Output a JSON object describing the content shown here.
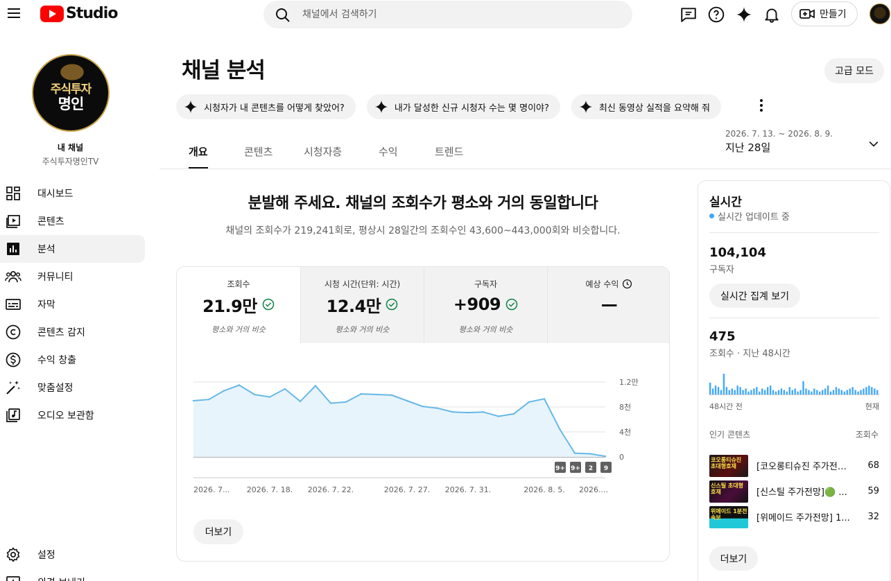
{
  "header": {
    "logo_text": "Studio",
    "search_placeholder": "채널에서 검색하기",
    "create_label": "만들기"
  },
  "sidebar": {
    "avatar_text_1": "주식투자",
    "avatar_text_2": "명인",
    "channel_label": "내 채널",
    "channel_name": "주식투자명인TV",
    "items": [
      {
        "label": "대시보드",
        "icon": "dashboard-icon"
      },
      {
        "label": "콘텐츠",
        "icon": "content-icon"
      },
      {
        "label": "분석",
        "icon": "analytics-icon"
      },
      {
        "label": "커뮤니티",
        "icon": "community-icon"
      },
      {
        "label": "자막",
        "icon": "subtitles-icon"
      },
      {
        "label": "콘텐츠 감지",
        "icon": "copyright-icon"
      },
      {
        "label": "수익 창출",
        "icon": "monetization-icon"
      },
      {
        "label": "맞춤설정",
        "icon": "customization-icon"
      },
      {
        "label": "오디오 보관함",
        "icon": "audio-library-icon"
      }
    ],
    "bottom_items": [
      {
        "label": "설정",
        "icon": "settings-icon"
      },
      {
        "label": "의견 보내기",
        "icon": "feedback-icon"
      }
    ]
  },
  "main": {
    "title": "채널 분석",
    "advanced_label": "고급 모드",
    "chips": [
      "시청자가 내 콘텐츠를 어떻게 찾았어?",
      "내가 달성한 신규 시청자 수는 몇 명이야?",
      "최신 동영상 실적을 요약해 줘"
    ],
    "tabs": [
      "개요",
      "콘텐츠",
      "시청자층",
      "수익",
      "트렌드"
    ],
    "date_range": "2026. 7. 13. ~ 2026. 8. 9.",
    "date_label": "지난 28일",
    "headline": "분발해 주세요. 채널의 조회수가 평소와 거의 동일합니다",
    "subline": "채널의 조회수가 219,241회로, 평상시 28일간의 조회수인 43,600~443,000회와 비슷합니다.",
    "metrics": [
      {
        "title": "조회수",
        "value": "21.9만",
        "sub": "평소와 거의 비슷"
      },
      {
        "title": "시청 시간(단위: 시간)",
        "value": "12.4만",
        "sub": "평소와 거의 비슷"
      },
      {
        "title": "구독자",
        "value": "+909",
        "sub": "평소와 거의 비슷"
      },
      {
        "title": "예상 수익",
        "value": "—",
        "sub": ""
      }
    ],
    "more_label": "더보기"
  },
  "chart_data": {
    "type": "area",
    "x": [
      "2026. 7. 13.",
      "2026. 7. 14.",
      "2026. 7. 15.",
      "2026. 7. 16.",
      "2026. 7. 17.",
      "2026. 7. 18.",
      "2026. 7. 19.",
      "2026. 7. 20.",
      "2026. 7. 21.",
      "2026. 7. 22.",
      "2026. 7. 23.",
      "2026. 7. 24.",
      "2026. 7. 25.",
      "2026. 7. 26.",
      "2026. 7. 27.",
      "2026. 7. 28.",
      "2026. 7. 29.",
      "2026. 7. 30.",
      "2026. 7. 31.",
      "2026. 8. 1.",
      "2026. 8. 2.",
      "2026. 8. 3.",
      "2026. 8. 4.",
      "2026. 8. 5.",
      "2026. 8. 6.",
      "2026. 8. 7.",
      "2026. 8. 8.",
      "2026. 8. 9."
    ],
    "values": [
      9000,
      9200,
      10600,
      11500,
      10000,
      9600,
      10900,
      8900,
      11400,
      8600,
      8800,
      10100,
      10000,
      9900,
      9000,
      8100,
      7800,
      7200,
      7100,
      7200,
      6500,
      6900,
      8800,
      9300,
      4500,
      600,
      500,
      100
    ],
    "xtick_labels": [
      "2026. 7...",
      "2026. 7. 18.",
      "2026. 7. 22.",
      "2026. 7. 27.",
      "2026. 7. 31.",
      "2026. 8. 5.",
      "2026...."
    ],
    "ytick_labels": [
      "0",
      "4천",
      "8천",
      "1.2만"
    ],
    "ylim": [
      0,
      12000
    ],
    "grid": true,
    "badges": [
      "9+",
      "9+",
      "2",
      "9"
    ],
    "colors": {
      "line": "#65b8e6",
      "fill": "#e8f4fb"
    }
  },
  "realtime": {
    "title": "실시간",
    "live_label": "실시간 업데이트 중",
    "subscribers": "104,104",
    "subscribers_label": "구독자",
    "realtime_button": "실시간 집계 보기",
    "views": "475",
    "views_label": "조회수 · 지난 48시간",
    "axis_left": "48시간 전",
    "axis_right": "현재",
    "bars": [
      8,
      4,
      6,
      5,
      3,
      14,
      5,
      3,
      4,
      3,
      6,
      5,
      3,
      4,
      2,
      3,
      4,
      5,
      2,
      4,
      3,
      5,
      6,
      3,
      2,
      3,
      4,
      3,
      2,
      5,
      3,
      4,
      2,
      3,
      9,
      4,
      3,
      2,
      4,
      3,
      2,
      3,
      4,
      6,
      2,
      3,
      5,
      4,
      3,
      2,
      3,
      4,
      5,
      3,
      2,
      3,
      4,
      5,
      6,
      5,
      4,
      3
    ],
    "top_label": "인기 콘텐츠",
    "top_right": "조회수",
    "top_content": [
      {
        "title": "[코오롱티슈진 주가전망]...",
        "views": "68",
        "thumb_text": "코오롱티슈진\n초대형호재"
      },
      {
        "title": "[신스틸 주가전망]🟢 ...",
        "views": "59",
        "thumb_text": "신스틸\n초대형호재"
      },
      {
        "title": "[위메이드 주가전망] 1...",
        "views": "32",
        "thumb_text": "위메이드\n1분전속보"
      }
    ],
    "more_label": "더보기",
    "colors": {
      "bar": "#3ea6ff"
    }
  }
}
